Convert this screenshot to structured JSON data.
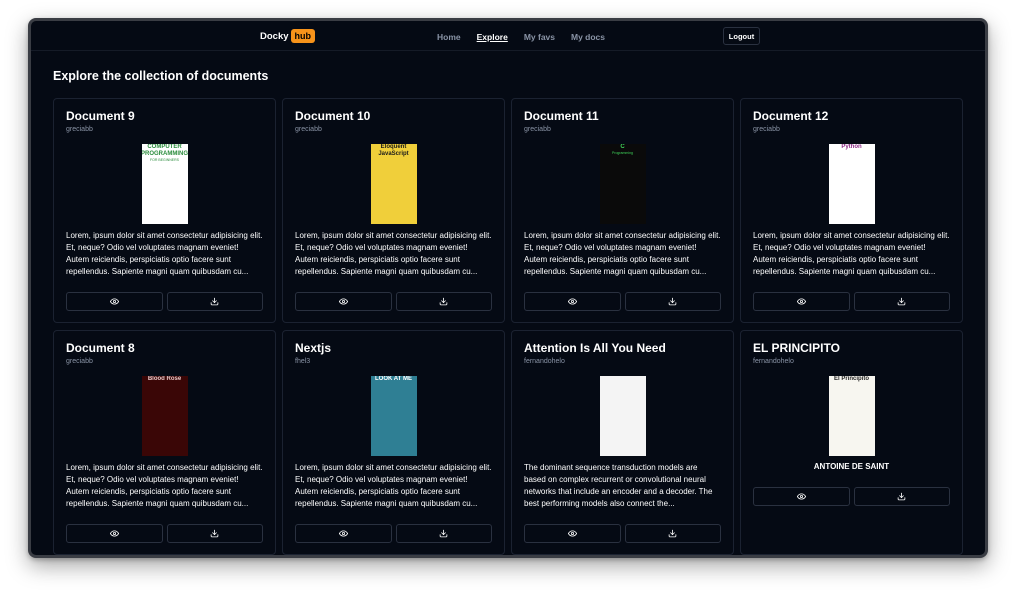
{
  "nav": {
    "logo_text": "Docky",
    "logo_badge": "hub",
    "links": [
      "Home",
      "Explore",
      "My favs",
      "My docs"
    ],
    "logout_label": "Logout"
  },
  "page_title": "Explore the collection of documents",
  "cards": [
    {
      "title": "Document 9",
      "author": "greciabb",
      "description": "Lorem, ipsum dolor sit amet consectetur adipisicing elit. Et, neque? Odio vel voluptates magnam eveniet! Autem reiciendis, perspiciatis optio facere sunt repellendus. Sapiente magni quam quibusdam cu...",
      "cover": {
        "title": "COMPUTER PROGRAMMING",
        "subtitle": "FOR BEGINNERS",
        "bg": "#ffffff",
        "fg": "#2a8c3c"
      }
    },
    {
      "title": "Document 10",
      "author": "greciabb",
      "description": "Lorem, ipsum dolor sit amet consectetur adipisicing elit. Et, neque? Odio vel voluptates magnam eveniet! Autem reiciendis, perspiciatis optio facere sunt repellendus. Sapiente magni quam quibusdam cu...",
      "cover": {
        "title": "Eloquent JavaScript",
        "subtitle": "",
        "bg": "#f0cf3a",
        "fg": "#1a1a1a"
      }
    },
    {
      "title": "Document 11",
      "author": "greciabb",
      "description": "Lorem, ipsum dolor sit amet consectetur adipisicing elit. Et, neque? Odio vel voluptates magnam eveniet! Autem reiciendis, perspiciatis optio facere sunt repellendus. Sapiente magni quam quibusdam cu...",
      "cover": {
        "title": "C",
        "subtitle": "Programming",
        "bg": "#0a0a0a",
        "fg": "#3fd45a"
      }
    },
    {
      "title": "Document 12",
      "author": "greciabb",
      "description": "Lorem, ipsum dolor sit amet consectetur adipisicing elit. Et, neque? Odio vel voluptates magnam eveniet! Autem reiciendis, perspiciatis optio facere sunt repellendus. Sapiente magni quam quibusdam cu...",
      "cover": {
        "title": "Python",
        "subtitle": "",
        "bg": "#ffffff",
        "fg": "#8c2a84"
      }
    },
    {
      "title": "Document 8",
      "author": "greciabb",
      "description": "Lorem, ipsum dolor sit amet consectetur adipisicing elit. Et, neque? Odio vel voluptates magnam eveniet! Autem reiciendis, perspiciatis optio facere sunt repellendus. Sapiente magni quam quibusdam cu...",
      "cover": {
        "title": "Blood Rose",
        "subtitle": "",
        "bg": "#3a0606",
        "fg": "#e8c8c8"
      }
    },
    {
      "title": "Nextjs",
      "author": "fhel3",
      "description": "Lorem, ipsum dolor sit amet consectetur adipisicing elit. Et, neque? Odio vel voluptates magnam eveniet! Autem reiciendis, perspiciatis optio facere sunt repellendus. Sapiente magni quam quibusdam cu...",
      "cover": {
        "title": "LOOK AT ME",
        "subtitle": "",
        "bg": "#2f7f94",
        "fg": "#ffffff"
      }
    },
    {
      "title": "Attention Is All You Need",
      "author": "fernandohelo",
      "description": "The dominant sequence transduction models are based on complex recurrent or convolutional neural networks that include an encoder and a decoder. The best performing models also connect the...",
      "cover": {
        "title": "",
        "subtitle": "",
        "bg": "#f4f4f4",
        "fg": "#555555"
      }
    },
    {
      "title": "EL PRINCIPITO",
      "author": "fernandohelo",
      "description": "",
      "subtitle": "ANTOINE DE SAINT",
      "cover": {
        "title": "El Principito",
        "subtitle": "",
        "bg": "#f7f6f0",
        "fg": "#222222"
      }
    }
  ],
  "icons": {
    "view": "eye-icon",
    "download": "download-icon"
  }
}
